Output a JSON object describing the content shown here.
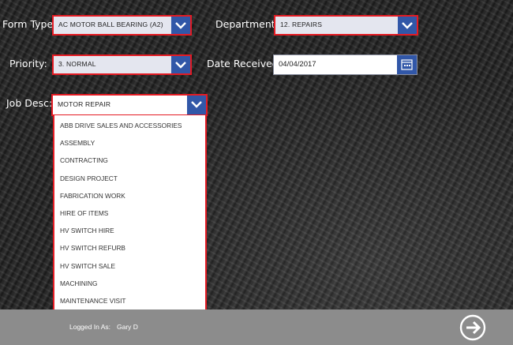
{
  "form": {
    "form_type": {
      "label": "Form Type:",
      "value": "AC MOTOR BALL BEARING (A2)"
    },
    "department": {
      "label": "Department:",
      "value": "12. REPAIRS"
    },
    "priority": {
      "label": "Priority:",
      "value": "3. NORMAL"
    },
    "date_received": {
      "label": "Date Received:",
      "value": "04/04/2017"
    },
    "job_desc": {
      "label": "Job Desc:",
      "value": "MOTOR REPAIR",
      "options": [
        "ABB DRIVE SALES AND ACCESSORIES",
        "ASSEMBLY",
        "CONTRACTING",
        "DESIGN PROJECT",
        "FABRICATION WORK",
        "HIRE OF ITEMS",
        "HV SWITCH HIRE",
        "HV SWITCH REFURB",
        "HV SWITCH SALE",
        "MACHINING",
        "MAINTENANCE VISIT"
      ]
    }
  },
  "footer": {
    "logged_in_label": "Logged In As:",
    "user": "Gary D"
  },
  "icons": {
    "dropdown": "chevron-down-icon",
    "calendar": "calendar-icon",
    "next": "arrow-right-circle-icon"
  },
  "colors": {
    "accent": "#3157a8",
    "border": "#e41b23",
    "footer": "#8c8c8c"
  }
}
